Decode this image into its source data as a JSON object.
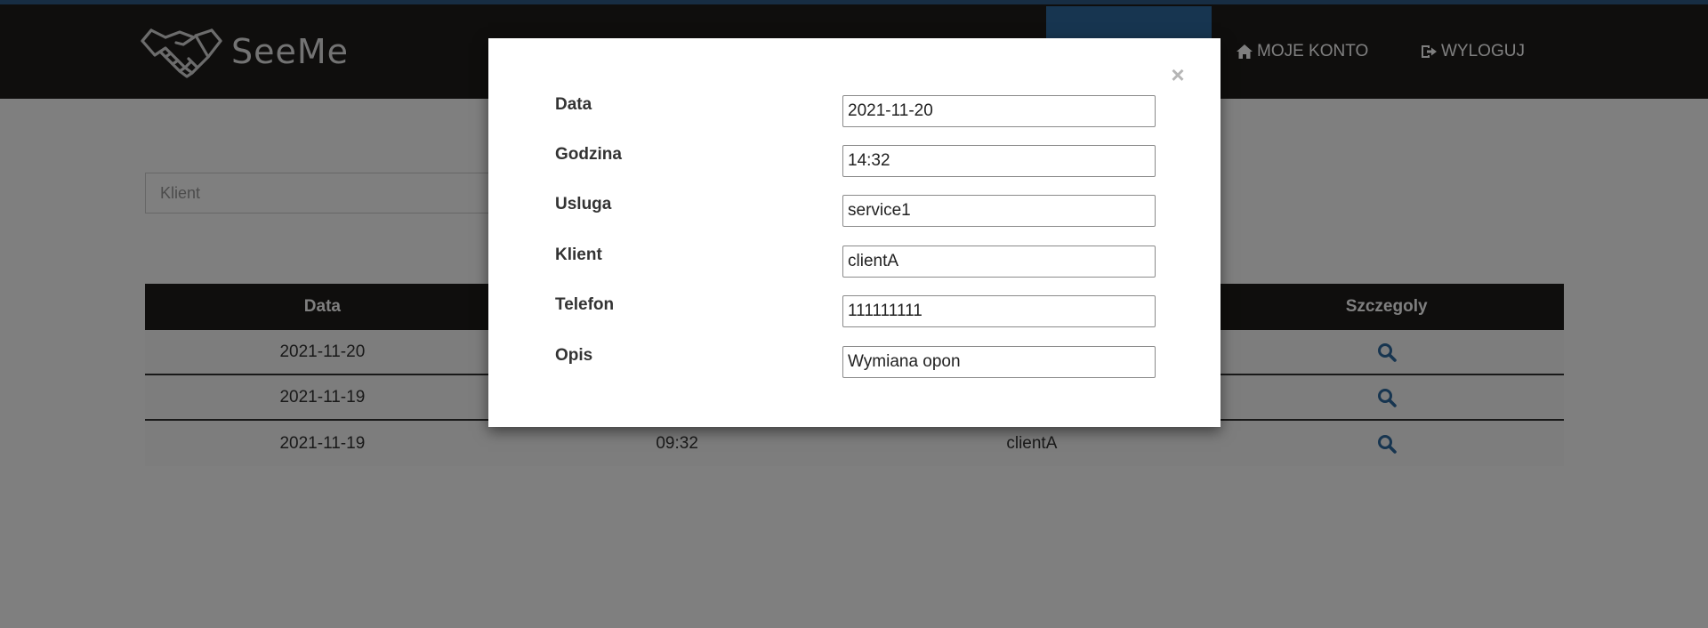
{
  "navbar": {
    "brand": "SeeMe",
    "links": [
      {
        "label": "MOJE KONTO",
        "icon": "home-icon"
      },
      {
        "label": "WYLOGUJ",
        "icon": "logout-icon"
      }
    ]
  },
  "filters": {
    "client_placeholder": "Klient"
  },
  "table": {
    "headers": [
      "Data",
      "",
      "",
      "Szczegoly"
    ],
    "rows": [
      {
        "date": "2021-11-20",
        "time": "",
        "client": ""
      },
      {
        "date": "2021-11-19",
        "time": "",
        "client": ""
      },
      {
        "date": "2021-11-19",
        "time": "09:32",
        "client": "clientA"
      }
    ]
  },
  "modal": {
    "close_label": "×",
    "fields": [
      {
        "label": "Data",
        "value": "2021-11-20"
      },
      {
        "label": "Godzina",
        "value": "14:32"
      },
      {
        "label": "Usluga",
        "value": "service1"
      },
      {
        "label": "Klient",
        "value": "clientA"
      },
      {
        "label": "Telefon",
        "value": "111111111"
      },
      {
        "label": "Opis",
        "value": "Wymiana opon"
      }
    ]
  },
  "colors": {
    "navbar": "#1e1c1b",
    "accent": "#2f6aa0",
    "search_icon": "#2f6aa0"
  }
}
